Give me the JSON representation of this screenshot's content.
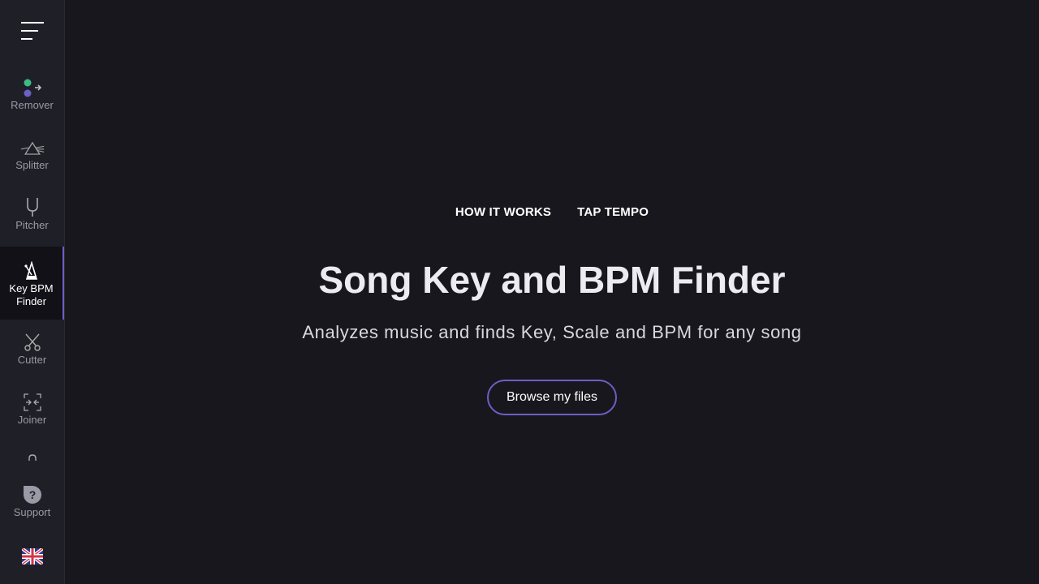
{
  "sidebar": {
    "menu_icon": "hamburger-menu-icon",
    "items": [
      {
        "label": "Remover",
        "icon": "remover-icon"
      },
      {
        "label": "Splitter",
        "icon": "prism-icon"
      },
      {
        "label": "Pitcher",
        "icon": "tuning-fork-icon"
      },
      {
        "label": "Key BPM Finder",
        "icon": "metronome-icon",
        "active": true
      },
      {
        "label": "Cutter",
        "icon": "scissors-icon"
      },
      {
        "label": "Joiner",
        "icon": "join-icon"
      },
      {
        "label": "",
        "icon": "recorder-icon"
      },
      {
        "label": "Support",
        "icon": "help-icon"
      },
      {
        "label": "",
        "icon": "uk-flag-icon"
      }
    ]
  },
  "main": {
    "links": [
      "HOW IT WORKS",
      "TAP TEMPO"
    ],
    "title": "Song Key and BPM Finder",
    "subtitle": "Analyzes music and finds Key, Scale and BPM for any song",
    "browse_label": "Browse my files"
  },
  "colors": {
    "background": "#18171d",
    "sidebar": "#1f1f27",
    "accent": "#6c5fc7",
    "green": "#3dbb84"
  }
}
